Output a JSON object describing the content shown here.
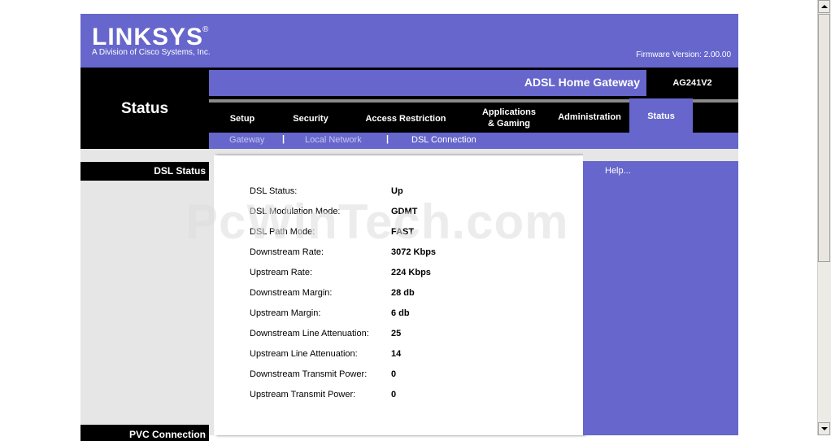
{
  "brand": {
    "logo": "LINKSYS",
    "logo_mark": "®",
    "tagline": "A Division of Cisco Systems, Inc.",
    "firmware": "Firmware Version: 2.00.00"
  },
  "page_title": "Status",
  "product": {
    "name": "ADSL Home Gateway",
    "model": "AG241V2"
  },
  "tabs": [
    {
      "label": "Setup"
    },
    {
      "label": "Security"
    },
    {
      "label": "Access Restriction"
    },
    {
      "label": "Applications & Gaming",
      "line1": "Applications",
      "line2": "& Gaming"
    },
    {
      "label": "Administration"
    },
    {
      "label": "Status",
      "active": true
    }
  ],
  "subtabs": [
    {
      "label": "Gateway"
    },
    {
      "label": "Local Network"
    },
    {
      "label": "DSL Connection",
      "active": true
    }
  ],
  "subtab_separator": "|",
  "sections": {
    "dsl_status": "DSL Status",
    "pvc_connection": "PVC Connection"
  },
  "help_link": "Help...",
  "dsl": [
    {
      "label": "DSL Status:",
      "value": "Up"
    },
    {
      "label": "DSL Modulation Mode:",
      "value": "GDMT"
    },
    {
      "label": "DSL Path Mode:",
      "value": "FAST"
    },
    {
      "label": "Downstream Rate:",
      "value": "3072 Kbps"
    },
    {
      "label": "Upstream Rate:",
      "value": "224 Kbps"
    },
    {
      "label": "Downstream Margin:",
      "value": "28 db"
    },
    {
      "label": "Upstream Margin:",
      "value": "6 db"
    },
    {
      "label": "Downstream Line Attenuation:",
      "value": "25"
    },
    {
      "label": "Upstream Line Attenuation:",
      "value": "14"
    },
    {
      "label": "Downstream Transmit Power:",
      "value": "0"
    },
    {
      "label": "Upstream Transmit Power:",
      "value": "0"
    }
  ],
  "watermark": "PcWinTech.com",
  "colors": {
    "accent": "#6666cc",
    "black": "#000000",
    "panel_gray": "#e6e6e6"
  }
}
